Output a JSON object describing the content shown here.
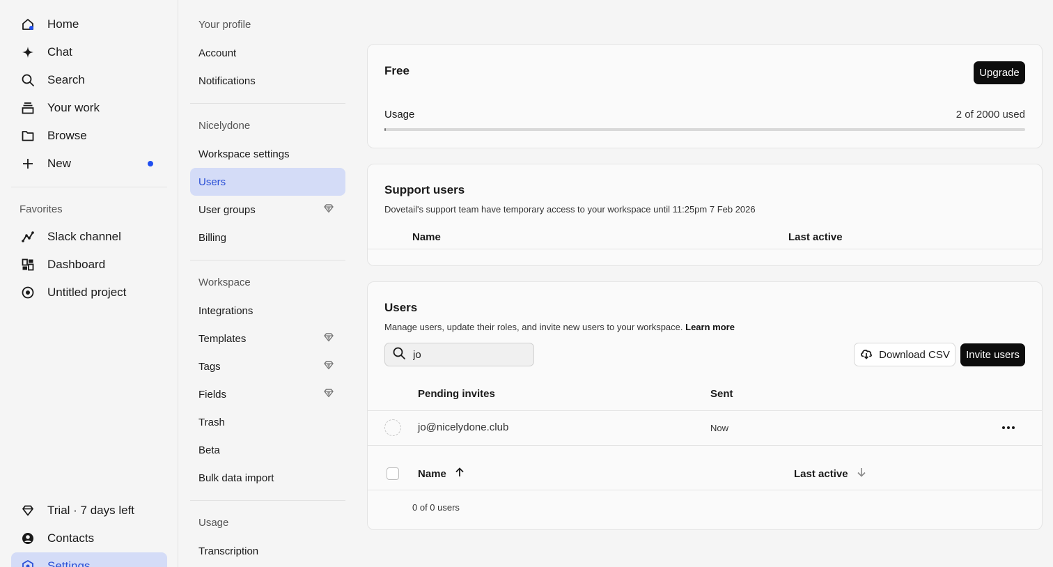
{
  "nav": {
    "primary": [
      {
        "label": "Home",
        "icon": "home-icon"
      },
      {
        "label": "Chat",
        "icon": "sparkle-icon"
      },
      {
        "label": "Search",
        "icon": "search-icon"
      },
      {
        "label": "Your work",
        "icon": "stack-icon"
      },
      {
        "label": "Browse",
        "icon": "folder-icon"
      },
      {
        "label": "New",
        "icon": "plus-icon"
      }
    ],
    "favorites_heading": "Favorites",
    "favorites": [
      {
        "label": "Slack channel",
        "icon": "chart-line-icon"
      },
      {
        "label": "Dashboard",
        "icon": "dashboard-icon"
      },
      {
        "label": "Untitled project",
        "icon": "target-icon"
      }
    ],
    "bottom": [
      {
        "label": "Trial · 7 days left",
        "icon": "diamond-icon"
      },
      {
        "label": "Contacts",
        "icon": "user-circle-icon"
      },
      {
        "label": "Settings",
        "icon": "settings-icon"
      }
    ],
    "accent_color": "#2a4fd6"
  },
  "subnav": {
    "profile_heading": "Your profile",
    "profile_items": [
      "Account",
      "Notifications"
    ],
    "org_heading": "Nicelydone",
    "org_items": [
      "Workspace settings",
      "Users",
      "User groups",
      "Billing"
    ],
    "workspace_heading": "Workspace",
    "workspace_items": [
      "Integrations",
      "Templates",
      "Tags",
      "Fields",
      "Trash",
      "Beta",
      "Bulk data import"
    ],
    "usage_heading": "Usage",
    "usage_items": [
      "Transcription"
    ]
  },
  "plan": {
    "name": "Free",
    "upgrade_label": "Upgrade",
    "usage_label": "Usage",
    "usage_text": "2 of 2000 used",
    "usage_fraction": 0.001
  },
  "support": {
    "title": "Support users",
    "description": "Dovetail's support team have temporary access to your workspace until 11:25pm 7 Feb 2026",
    "col_name": "Name",
    "col_last_active": "Last active"
  },
  "users": {
    "title": "Users",
    "description": "Manage users, update their roles, and invite new users to your workspace.",
    "learn_more": "Learn more",
    "search_value": "jo",
    "download_label": "Download CSV",
    "invite_label": "Invite users",
    "pending_header": "Pending invites",
    "sent_header": "Sent",
    "pending": [
      {
        "email": "jo@nicelydone.club",
        "sent": "Now"
      }
    ],
    "col_name": "Name",
    "col_last_active": "Last active",
    "count_text": "0 of 0 users"
  }
}
